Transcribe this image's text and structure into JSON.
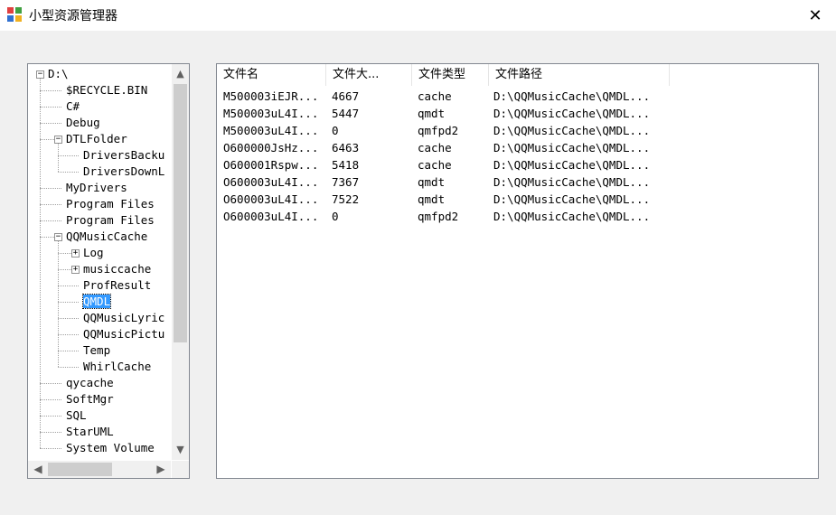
{
  "window": {
    "title": "小型资源管理器",
    "close": "✕"
  },
  "tree": [
    {
      "label": "D:\\",
      "level": 0,
      "expander": "−",
      "selected": false
    },
    {
      "label": "$RECYCLE.BIN",
      "level": 1,
      "expander": "",
      "selected": false
    },
    {
      "label": "C#",
      "level": 1,
      "expander": "",
      "selected": false
    },
    {
      "label": "Debug",
      "level": 1,
      "expander": "",
      "selected": false
    },
    {
      "label": "DTLFolder",
      "level": 1,
      "expander": "−",
      "selected": false
    },
    {
      "label": "DriversBacku",
      "level": 2,
      "expander": "",
      "selected": false
    },
    {
      "label": "DriversDownL",
      "level": 2,
      "expander": "",
      "selected": false
    },
    {
      "label": "MyDrivers",
      "level": 1,
      "expander": "",
      "selected": false
    },
    {
      "label": "Program Files",
      "level": 1,
      "expander": "",
      "selected": false
    },
    {
      "label": "Program Files",
      "level": 1,
      "expander": "",
      "selected": false
    },
    {
      "label": "QQMusicCache",
      "level": 1,
      "expander": "−",
      "selected": false
    },
    {
      "label": "Log",
      "level": 2,
      "expander": "+",
      "selected": false
    },
    {
      "label": "musiccache",
      "level": 2,
      "expander": "+",
      "selected": false
    },
    {
      "label": "ProfResult",
      "level": 2,
      "expander": "",
      "selected": false
    },
    {
      "label": "QMDL",
      "level": 2,
      "expander": "",
      "selected": true
    },
    {
      "label": "QQMusicLyric",
      "level": 2,
      "expander": "",
      "selected": false
    },
    {
      "label": "QQMusicPictu",
      "level": 2,
      "expander": "",
      "selected": false
    },
    {
      "label": "Temp",
      "level": 2,
      "expander": "",
      "selected": false
    },
    {
      "label": "WhirlCache",
      "level": 2,
      "expander": "",
      "selected": false
    },
    {
      "label": "qycache",
      "level": 1,
      "expander": "",
      "selected": false
    },
    {
      "label": "SoftMgr",
      "level": 1,
      "expander": "",
      "selected": false
    },
    {
      "label": "SQL",
      "level": 1,
      "expander": "",
      "selected": false
    },
    {
      "label": "StarUML",
      "level": 1,
      "expander": "",
      "selected": false
    },
    {
      "label": "System Volume",
      "level": 1,
      "expander": "",
      "selected": false
    }
  ],
  "scroll": {
    "up": "▲",
    "down": "▼",
    "left": "◀",
    "right": "▶"
  },
  "list": {
    "columns": [
      "文件名",
      "文件大...",
      "文件类型",
      "文件路径"
    ],
    "rows": [
      [
        "M500003iEJR...",
        "4667",
        "cache",
        "D:\\QQMusicCache\\QMDL..."
      ],
      [
        "M500003uL4I...",
        "5447",
        "qmdt",
        "D:\\QQMusicCache\\QMDL..."
      ],
      [
        "M500003uL4I...",
        "0",
        "qmfpd2",
        "D:\\QQMusicCache\\QMDL..."
      ],
      [
        "O600000JsHz...",
        "6463",
        "cache",
        "D:\\QQMusicCache\\QMDL..."
      ],
      [
        "O600001Rspw...",
        "5418",
        "cache",
        "D:\\QQMusicCache\\QMDL..."
      ],
      [
        "O600003uL4I...",
        "7367",
        "qmdt",
        "D:\\QQMusicCache\\QMDL..."
      ],
      [
        "O600003uL4I...",
        "7522",
        "qmdt",
        "D:\\QQMusicCache\\QMDL..."
      ],
      [
        "O600003uL4I...",
        "0",
        "qmfpd2",
        "D:\\QQMusicCache\\QMDL..."
      ]
    ]
  },
  "colors": {
    "selection": "#3399ff",
    "border": "#828790",
    "background": "#f0f0f0"
  }
}
